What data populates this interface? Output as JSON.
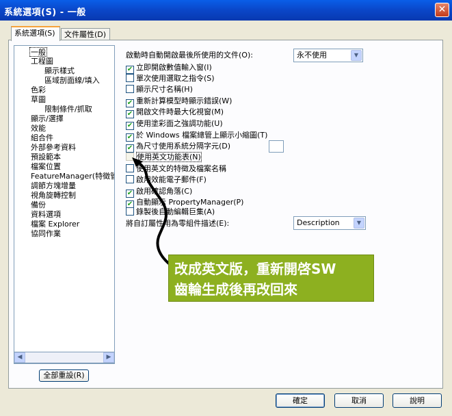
{
  "window": {
    "title": "系統選項(S) - 一般",
    "close_glyph": "✕"
  },
  "tabs": [
    {
      "label": "系統選項(S)"
    },
    {
      "label": "文件屬性(D)"
    }
  ],
  "tree": {
    "items": [
      {
        "label": "一般"
      },
      {
        "label": "工程圖"
      },
      {
        "label": "顯示樣式"
      },
      {
        "label": "區域剖面線/填入"
      },
      {
        "label": "色彩"
      },
      {
        "label": "草圖"
      },
      {
        "label": "限制條件/抓取"
      },
      {
        "label": "顯示/選擇"
      },
      {
        "label": "效能"
      },
      {
        "label": "組合件"
      },
      {
        "label": "外部參考資料"
      },
      {
        "label": "預設範本"
      },
      {
        "label": "檔案位置"
      },
      {
        "label": "FeatureManager(特徵管理"
      },
      {
        "label": "調節方塊增量"
      },
      {
        "label": "視角旋轉控制"
      },
      {
        "label": "備份"
      },
      {
        "label": "資料選項"
      },
      {
        "label": "檔案 Explorer"
      },
      {
        "label": "協同作業"
      }
    ],
    "scroll_left": "◀",
    "scroll_right": "▶"
  },
  "reset_button": "全部重設(R)",
  "options": {
    "open_last_label": "啟動時自動開啟最後所使用的文件(O):",
    "open_last_value": "永不使用",
    "dropdown_glyph": "▼",
    "check_glyph": "✔",
    "checkboxes": [
      {
        "label": "立即開啟數值輸入窗(I)",
        "checked": true
      },
      {
        "label": "單次使用選取之指令(S)",
        "checked": false
      },
      {
        "label": "顯示尺寸名稱(H)",
        "checked": false
      },
      {
        "label": "重新計算模型時顯示錯誤(W)",
        "checked": true
      },
      {
        "label": "開啟文件時最大化視窗(M)",
        "checked": true
      },
      {
        "label": "使用塗彩面之強調功能(U)",
        "checked": true
      },
      {
        "label": "於 Windows 檔案總管上顯示小縮圖(T)",
        "checked": true
      },
      {
        "label": "為尺寸使用系統分隔字元(D)",
        "checked": true
      },
      {
        "label": "使用英文功能表(N)",
        "checked": false
      },
      {
        "label": "使用英文的特徵及檔案名稱",
        "checked": false
      },
      {
        "label": "啟用效能電子郵件(F)",
        "checked": false
      },
      {
        "label": "啟用確認角落(C)",
        "checked": true
      },
      {
        "label": "自動顯示 PropertyManager(P)",
        "checked": true
      },
      {
        "label": "錄製後自動編輯巨集(A)",
        "checked": false
      }
    ],
    "desc_label": "將自訂屬性用為零組件描述(E):",
    "desc_value": "Description"
  },
  "annotation": {
    "line1": "改成英文版，重新開啓SW",
    "line2": "齒輪生成後再改回來",
    "background": "#8db020"
  },
  "buttons": {
    "ok": "確定",
    "cancel": "取消",
    "help": "說明"
  }
}
